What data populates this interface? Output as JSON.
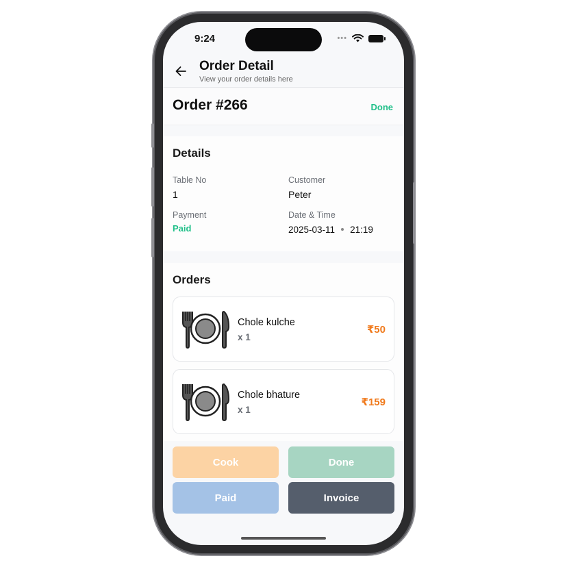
{
  "status_bar": {
    "time": "9:24",
    "dots": "•••"
  },
  "header": {
    "title": "Order Detail",
    "subtitle": "View your order details here"
  },
  "order": {
    "title": "Order #266",
    "status": "Done",
    "status_color": "#22c08a"
  },
  "details": {
    "title": "Details",
    "table_label": "Table No",
    "table_value": "1",
    "customer_label": "Customer",
    "customer_value": "Peter",
    "payment_label": "Payment",
    "payment_value": "Paid",
    "datetime_label": "Date & Time",
    "date": "2025-03-11",
    "time": "21:19"
  },
  "orders": {
    "title": "Orders",
    "items": [
      {
        "name": "Chole kulche",
        "qty": "x 1",
        "price": "₹50",
        "icon": "plate-cutlery-icon"
      },
      {
        "name": "Chole bhature",
        "qty": "x 1",
        "price": "₹159",
        "icon": "plate-cutlery-icon"
      }
    ]
  },
  "actions": {
    "cook": "Cook",
    "done": "Done",
    "paid": "Paid",
    "invoice": "Invoice"
  },
  "colors": {
    "accent_green": "#22c08a",
    "price_orange": "#f07a1c",
    "invoice_dark": "#555e6c"
  }
}
